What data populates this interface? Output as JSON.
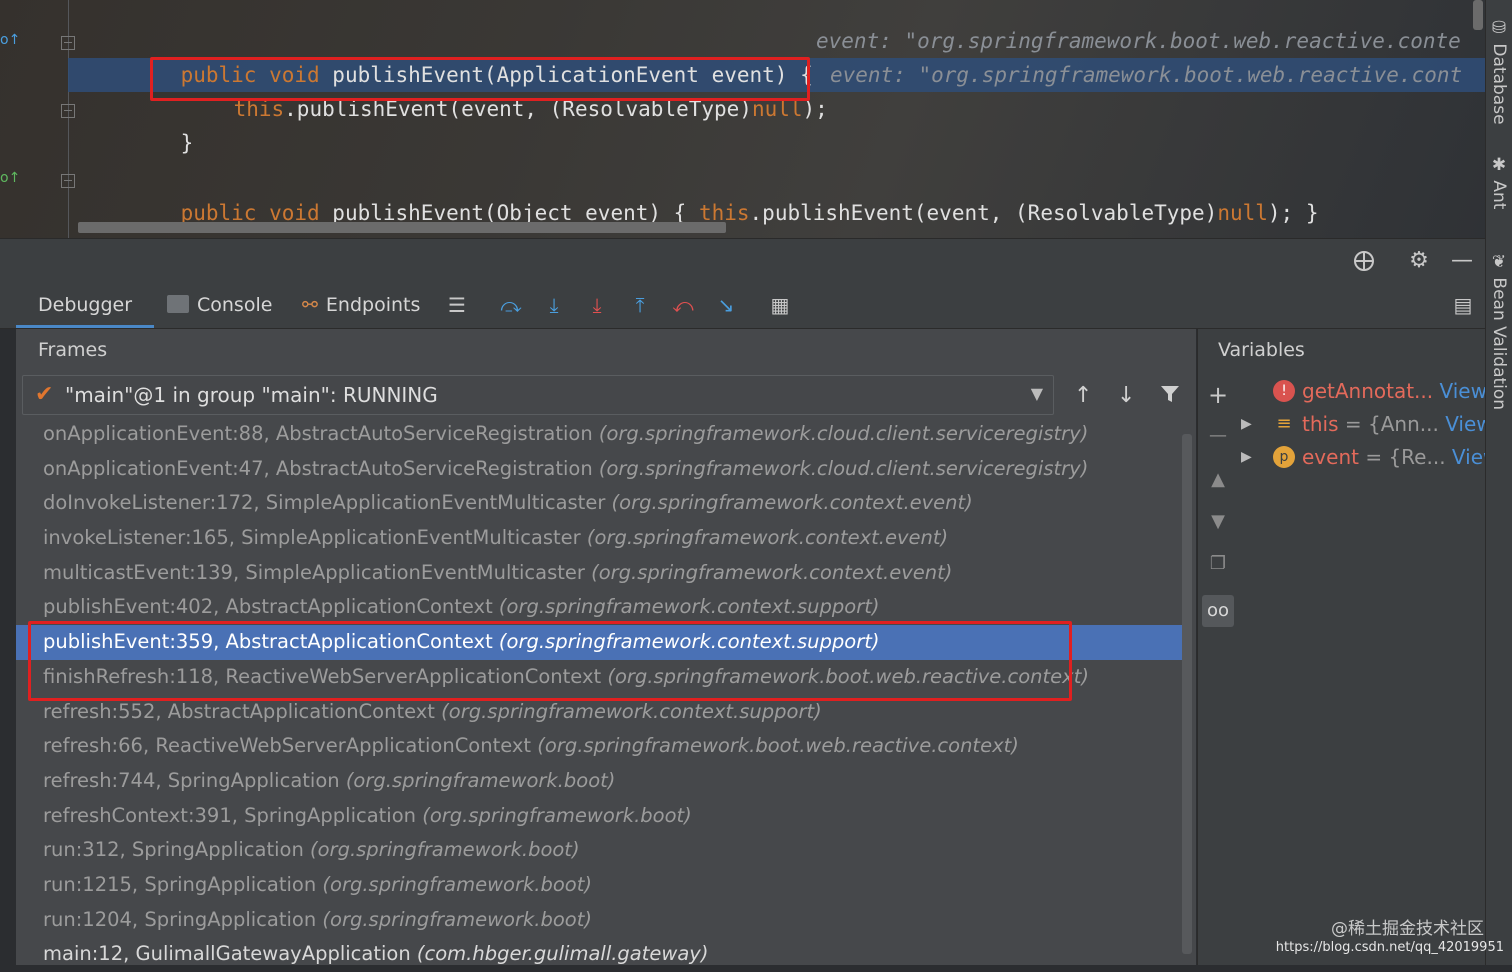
{
  "editor": {
    "lines": [
      {
        "kw": "public void ",
        "text": "publishEvent(ApplicationEvent event) {",
        "hint": "event: \"org.springframework.boot.web.reactive.conte"
      },
      {
        "kw": "this",
        "text": ".publishEvent(event, (ResolvableType)",
        "kw2": "null",
        "tail": ");",
        "hint": "event: \"org.springframework.boot.web.reactive.cont"
      },
      {
        "text": "}"
      },
      {
        "kw": "public void ",
        "text": "publishEvent(Object event) { ",
        "kw2": "this",
        "mid": ".publishEvent(event, (ResolvableType)",
        "kw3": "null",
        "tail": "); }"
      }
    ]
  },
  "panel_header": {
    "icons": [
      "crosshair-icon",
      "gear-icon",
      "minimize-icon"
    ]
  },
  "toolbar": {
    "tabs": {
      "debugger": "Debugger",
      "console": "Console",
      "endpoints": "Endpoints"
    }
  },
  "frames": {
    "title": "Frames",
    "thread": "\"main\"@1 in group \"main\": RUNNING",
    "items": [
      {
        "method": "onApplicationEvent:88, AbstractAutoServiceRegistration ",
        "pkg": "(org.springframework.cloud.client.serviceregistry)"
      },
      {
        "method": "onApplicationEvent:47, AbstractAutoServiceRegistration ",
        "pkg": "(org.springframework.cloud.client.serviceregistry)"
      },
      {
        "method": "doInvokeListener:172, SimpleApplicationEventMulticaster ",
        "pkg": "(org.springframework.context.event)"
      },
      {
        "method": "invokeListener:165, SimpleApplicationEventMulticaster ",
        "pkg": "(org.springframework.context.event)"
      },
      {
        "method": "multicastEvent:139, SimpleApplicationEventMulticaster ",
        "pkg": "(org.springframework.context.event)"
      },
      {
        "method": "publishEvent:402, AbstractApplicationContext ",
        "pkg": "(org.springframework.context.support)"
      },
      {
        "method": "publishEvent:359, AbstractApplicationContext ",
        "pkg": "(org.springframework.context.support)"
      },
      {
        "method": "finishRefresh:118, ReactiveWebServerApplicationContext ",
        "pkg": "(org.springframework.boot.web.reactive.context)"
      },
      {
        "method": "refresh:552, AbstractApplicationContext ",
        "pkg": "(org.springframework.context.support)"
      },
      {
        "method": "refresh:66, ReactiveWebServerApplicationContext ",
        "pkg": "(org.springframework.boot.web.reactive.context)"
      },
      {
        "method": "refresh:744, SpringApplication ",
        "pkg": "(org.springframework.boot)"
      },
      {
        "method": "refreshContext:391, SpringApplication ",
        "pkg": "(org.springframework.boot)"
      },
      {
        "method": "run:312, SpringApplication ",
        "pkg": "(org.springframework.boot)"
      },
      {
        "method": "run:1215, SpringApplication ",
        "pkg": "(org.springframework.boot)"
      },
      {
        "method": "run:1204, SpringApplication ",
        "pkg": "(org.springframework.boot)"
      },
      {
        "method": "main:12, GulimallGatewayApplication ",
        "pkg": "(com.hbger.gulimall.gateway)"
      }
    ]
  },
  "variables": {
    "title": "Variables",
    "items": [
      {
        "name": "getAnnotat...",
        "eq": "",
        "value": "",
        "link": "View",
        "icon": "!"
      },
      {
        "name": "this",
        "eq": " = ",
        "value": "{Ann...",
        "link": "View",
        "icon": "≡"
      },
      {
        "name": "event",
        "eq": " = ",
        "value": "{Re...",
        "link": "View",
        "icon": "p"
      }
    ]
  },
  "right_stripe": {
    "database": "Database",
    "ant": "Ant",
    "bean_validation": "Bean Validation"
  },
  "watermark": {
    "line1": "@稀土掘金技术社区",
    "line2": "https://blog.csdn.net/qq_42019951"
  },
  "colors": {
    "selection": "#4a71b5",
    "highlight_box": "#e02020",
    "keyword": "#cc7832"
  }
}
